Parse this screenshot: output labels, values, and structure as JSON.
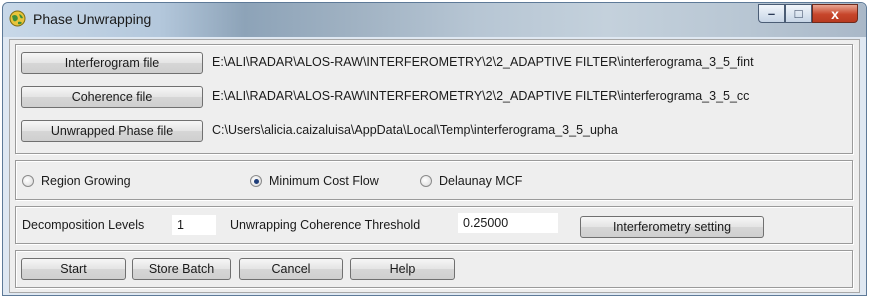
{
  "window": {
    "title": "Phase Unwrapping",
    "minimize": "–",
    "maximize": "□",
    "close": "x"
  },
  "files": [
    {
      "button": "Interferogram file",
      "path": "E:\\ALI\\RADAR\\ALOS-RAW\\INTERFEROMETRY\\2\\2_ADAPTIVE FILTER\\interferograma_3_5_fint"
    },
    {
      "button": "Coherence file",
      "path": "E:\\ALI\\RADAR\\ALOS-RAW\\INTERFEROMETRY\\2\\2_ADAPTIVE FILTER\\interferograma_3_5_cc"
    },
    {
      "button": "Unwrapped Phase file",
      "path": "C:\\Users\\alicia.caizaluisa\\AppData\\Local\\Temp\\interferograma_3_5_upha"
    }
  ],
  "method": {
    "options": [
      "Region Growing",
      "Minimum Cost Flow",
      "Delaunay MCF"
    ],
    "selected": "Minimum Cost Flow"
  },
  "params": {
    "decomposition_label": "Decomposition Levels",
    "decomposition_value": "1",
    "threshold_label": "Unwrapping Coherence Threshold",
    "threshold_value": "0.25000",
    "interferometry_button": "Interferometry setting"
  },
  "actions": {
    "start": "Start",
    "store_batch": "Store Batch",
    "cancel": "Cancel",
    "help": "Help"
  }
}
